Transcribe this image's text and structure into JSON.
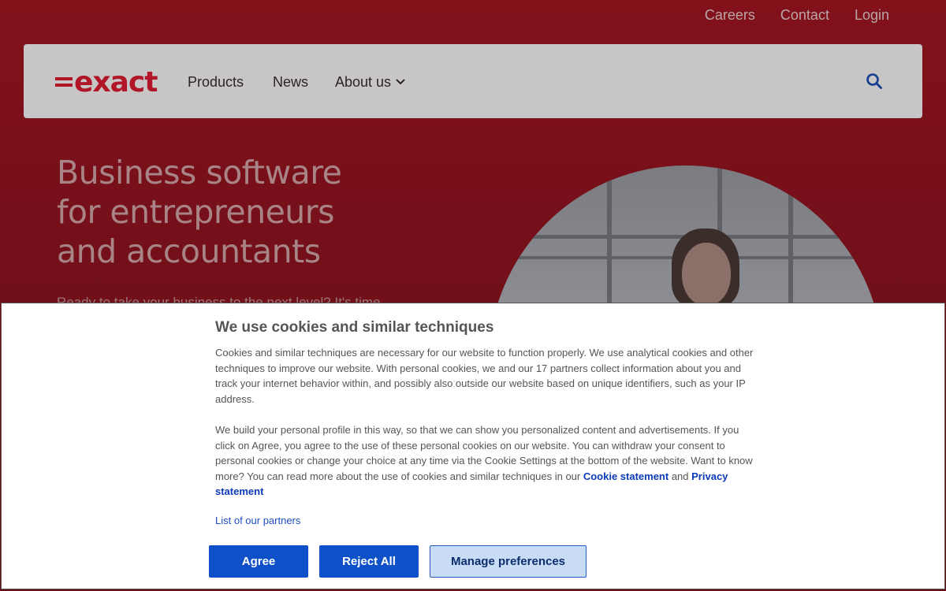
{
  "utility_nav": {
    "careers": "Careers",
    "contact": "Contact",
    "login": "Login"
  },
  "main_nav": {
    "logo_text": "=exact",
    "products": "Products",
    "news": "News",
    "about": "About us",
    "about_icon": "chevron-down-icon",
    "search_icon": "search-icon"
  },
  "hero": {
    "title": "Business software for entrepreneurs and accountants",
    "subtitle": "Ready to take your business to the next level? It's time"
  },
  "cookie": {
    "title": "We use cookies and similar techniques",
    "p1": "Cookies and similar techniques are necessary for our website to function properly. We use analytical cookies and other techniques to improve our website. With personal cookies, we and our 17 partners collect information about you and track your internet behavior within, and possibly also outside our website based on unique identifiers, such as your IP address.",
    "p2_text": "We build your personal profile in this way, so that we can show you personalized content and advertisements. If you click on Agree, you agree to the use of these personal cookies on our website. You can withdraw your consent to personal cookies or change your choice at any time via the Cookie Settings at the bottom of the website. Want to know more? You can read more about the use of cookies and similar techniques in our ",
    "cookie_statement": "Cookie statement",
    "and": " and ",
    "privacy_statement": "Privacy statement",
    "partners_link": "List of our partners",
    "agree": "Agree",
    "reject": "Reject All",
    "manage": "Manage preferences"
  },
  "colors": {
    "brand_red": "#c8102e",
    "button_blue": "#0e50c8",
    "link_blue": "#0b3bb6"
  }
}
